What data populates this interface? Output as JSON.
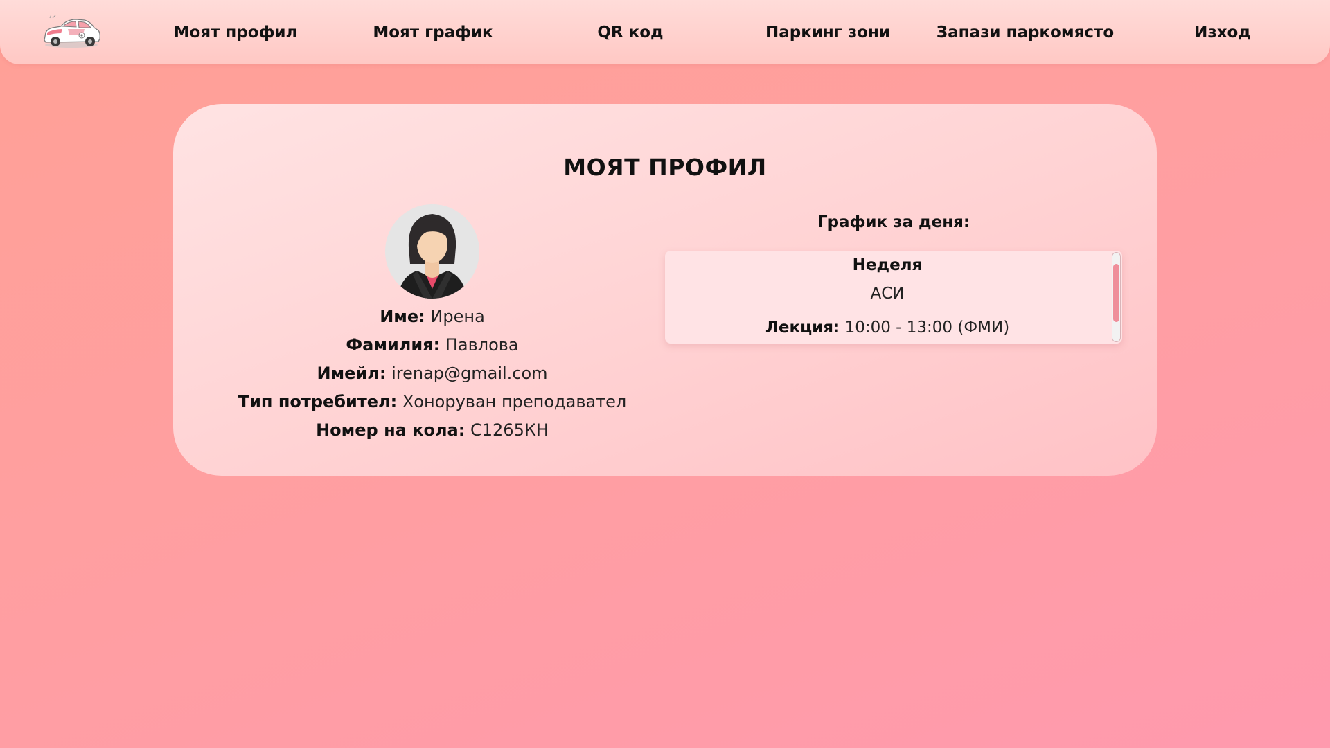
{
  "nav": {
    "logo_icon": "car-logo-icon",
    "items": [
      {
        "label": "Моят профил"
      },
      {
        "label": "Моят график"
      },
      {
        "label": "QR код"
      },
      {
        "label": "Паркинг зони"
      },
      {
        "label": "Запази паркомясто"
      },
      {
        "label": "Изход"
      }
    ]
  },
  "profile": {
    "title": "МОЯТ ПРОФИЛ",
    "avatar_icon": "user-avatar-icon",
    "fields": [
      {
        "key": "Име:",
        "value": "Ирена"
      },
      {
        "key": "Фамилия:",
        "value": "Павлова"
      },
      {
        "key": "Имейл:",
        "value": "irenap@gmail.com"
      },
      {
        "key": "Тип потребител:",
        "value": "Хоноруван преподавател"
      },
      {
        "key": "Номер на кола:",
        "value": "С1265КН"
      }
    ]
  },
  "schedule": {
    "heading": "График за деня:",
    "day": "Неделя",
    "subject": "АСИ",
    "lecture_key": "Лекция:",
    "lecture_value": "10:00 - 13:00 (ФМИ)"
  },
  "colors": {
    "background": "#ff9fa0",
    "card": "#ffd2d3",
    "scroll_thumb": "#ef8e9a"
  }
}
